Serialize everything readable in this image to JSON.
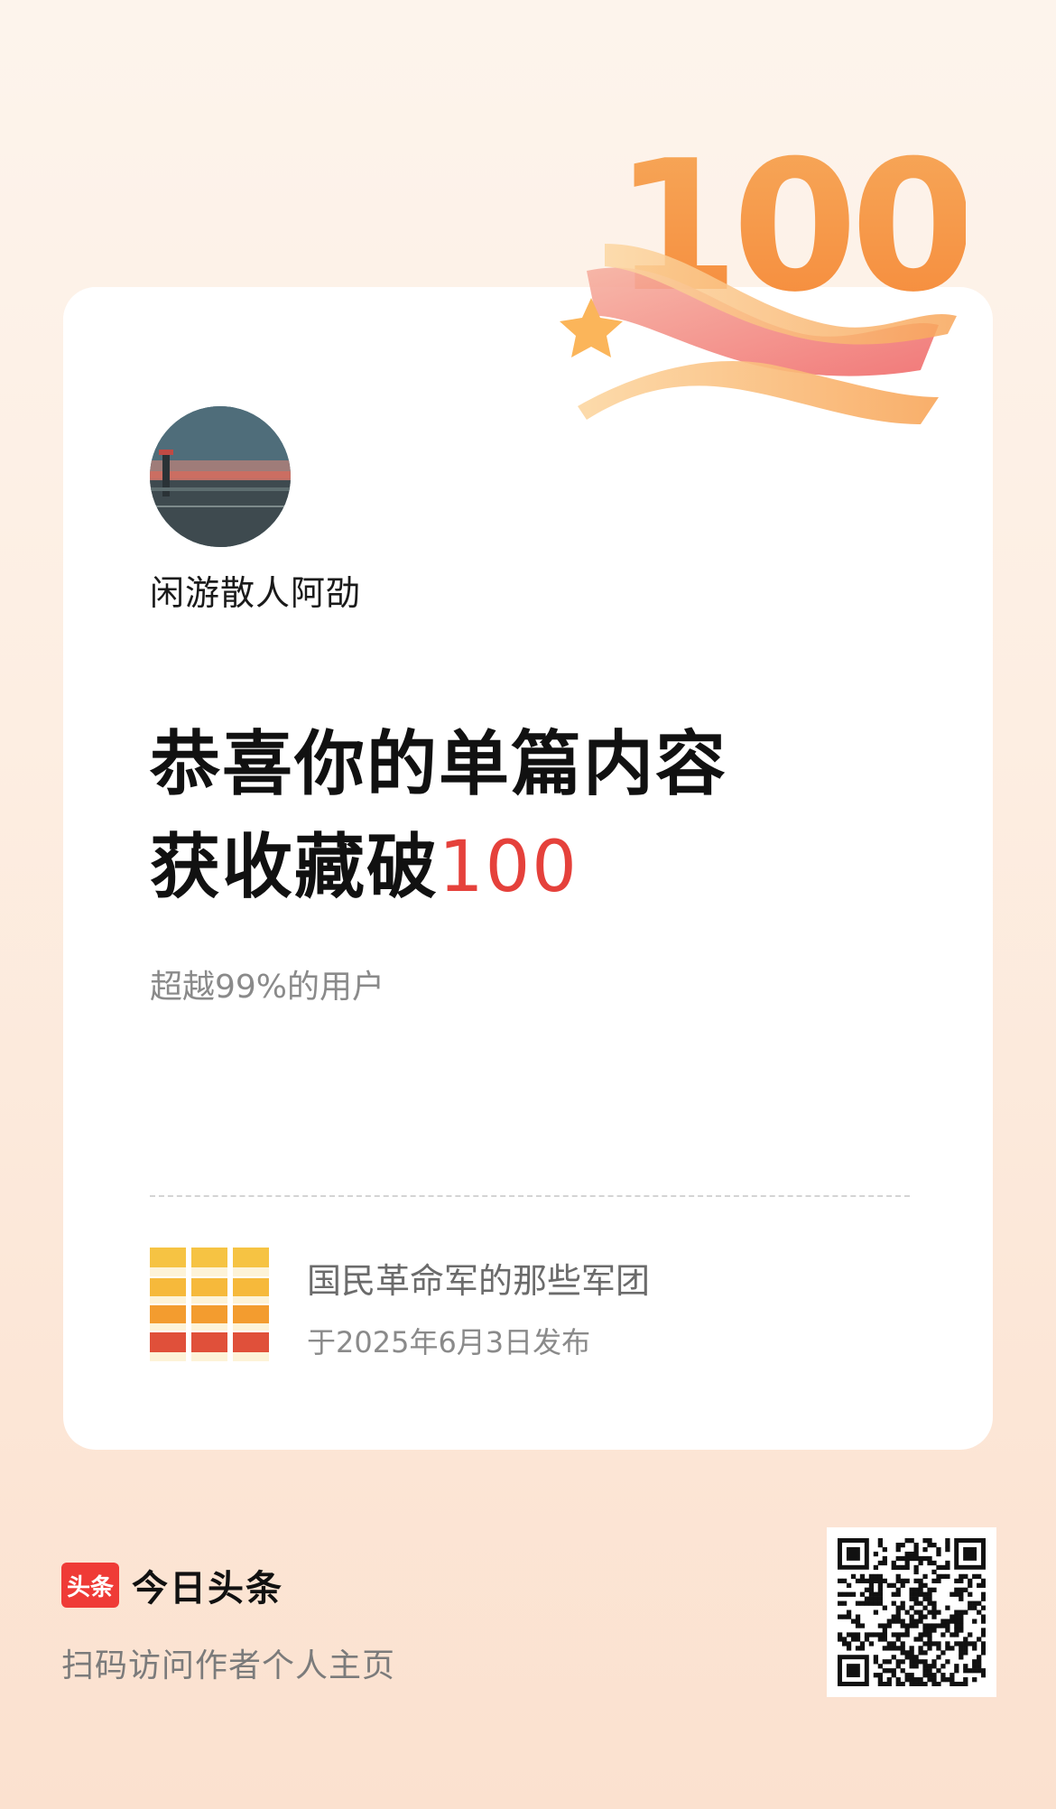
{
  "badge": {
    "number": "100"
  },
  "author": {
    "name": "闲游散人阿劭"
  },
  "headline": {
    "line1": "恭喜你的单篇内容",
    "line2_prefix": "获收藏破",
    "line2_number": "100"
  },
  "stat": {
    "text": "超越99%的用户"
  },
  "article": {
    "title": "国民革命军的那些军团",
    "date": "于2025年6月3日发布"
  },
  "footer": {
    "logo_text": "头条",
    "brand_name": "今日头条",
    "hint": "扫码访问作者个人主页"
  },
  "colors": {
    "accent_red": "#e5413b",
    "brand_red": "#ef3b36",
    "badge_orange": "#f59a47"
  }
}
